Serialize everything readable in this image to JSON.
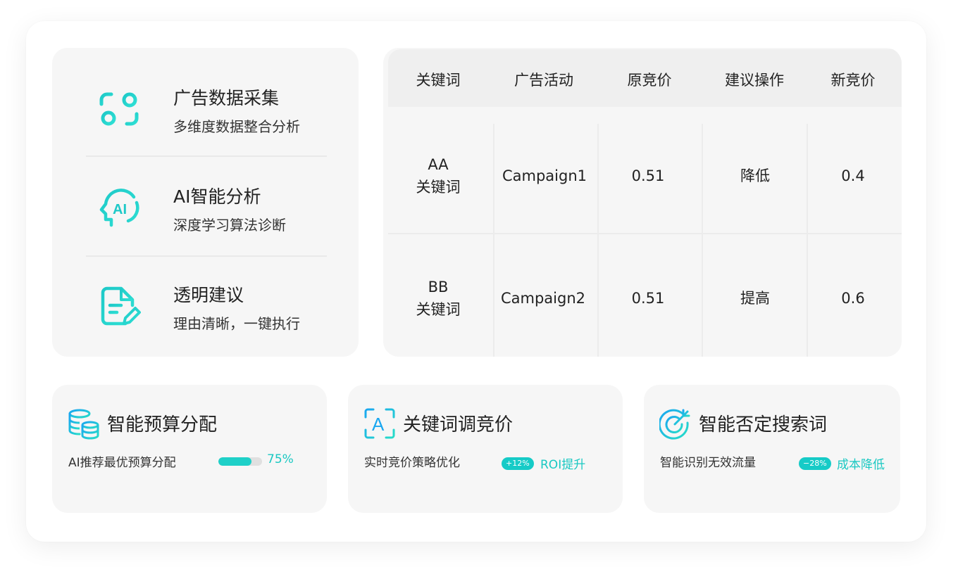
{
  "features": [
    {
      "title": "广告数据采集",
      "subtitle": "多维度数据整合分析",
      "icon": "data-collect-icon"
    },
    {
      "title": "AI智能分析",
      "subtitle": "深度学习算法诊断",
      "icon": "ai-head-icon"
    },
    {
      "title": "透明建议",
      "subtitle": "理由清晰，一键执行",
      "icon": "document-edit-icon"
    }
  ],
  "ai_icon_text": "AI",
  "table": {
    "headers": [
      "关键词",
      "广告活动",
      "原竞价",
      "建议操作",
      "新竞价"
    ],
    "rows": [
      {
        "keyword_line1": "AA",
        "keyword_line2": "关键词",
        "campaign": "Campaign1",
        "old_bid": "0.51",
        "action": "降低",
        "new_bid": "0.4"
      },
      {
        "keyword_line1": "BB",
        "keyword_line2": "关键词",
        "campaign": "Campaign2",
        "old_bid": "0.51",
        "action": "提高",
        "new_bid": "0.6"
      }
    ]
  },
  "cards": {
    "budget": {
      "title": "智能预算分配",
      "subtitle": "AI推荐最优预算分配",
      "progress": 75,
      "progress_label": "75%",
      "icon": "database-stack-icon"
    },
    "bidding": {
      "title": "关键词调竞价",
      "subtitle": "实时竞价策略优化",
      "badge": "+12%",
      "highlight": "ROI提升",
      "icon": "keyword-frame-icon",
      "icon_letter": "A"
    },
    "negative": {
      "title": "智能否定搜索词",
      "subtitle": "智能识别无效流量",
      "badge": "−28%",
      "highlight": "成本降低",
      "icon": "target-arrow-icon"
    }
  },
  "colors": {
    "accent": "#19c8c2",
    "accent_light": "#3ee3d8",
    "accent_blue": "#1aa7f0",
    "card_bg": "#f6f6f6"
  }
}
